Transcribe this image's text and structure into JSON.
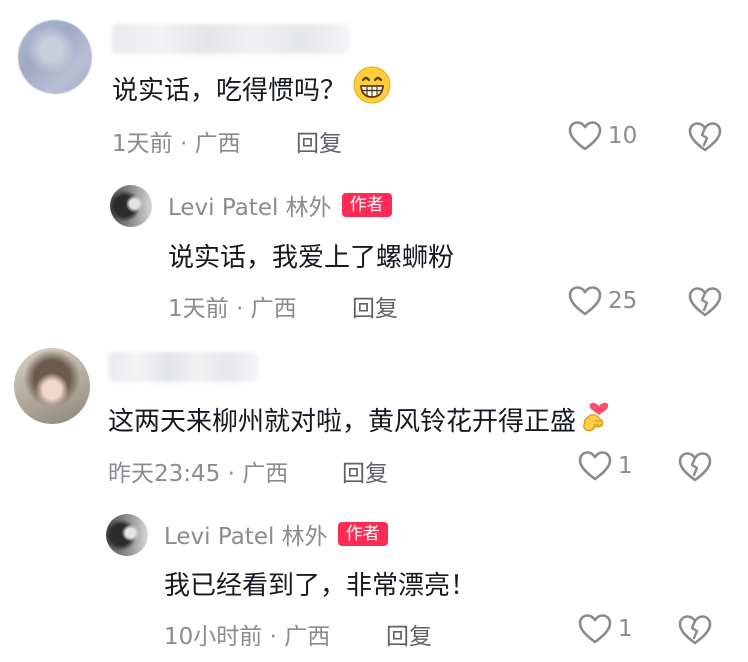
{
  "comments": [
    {
      "text": "说实话，吃得惯吗？",
      "emoji": "grinning-face-emoji",
      "meta": "1天前 · 广西",
      "reply_label": "回复",
      "likes": "10",
      "reply": {
        "username": "Levi Patel 林外",
        "badge": "作者",
        "text": "说实话，我爱上了螺蛳粉",
        "meta": "1天前 · 广西",
        "reply_label": "回复",
        "likes": "25"
      }
    },
    {
      "text": "这两天来柳州就对啦，黄风铃花开得正盛",
      "emoji": "heart-hands-emoji",
      "meta": "昨天23:45 · 广西",
      "reply_label": "回复",
      "likes": "1",
      "reply": {
        "username": "Levi Patel 林外",
        "badge": "作者",
        "text": "我已经看到了，非常漂亮！",
        "meta": "10小时前 · 广西",
        "reply_label": "回复",
        "likes": "1"
      }
    }
  ],
  "colors": {
    "accent_badge": "#fe2c55",
    "text_primary": "#161823",
    "text_secondary": "#8a8b91"
  }
}
